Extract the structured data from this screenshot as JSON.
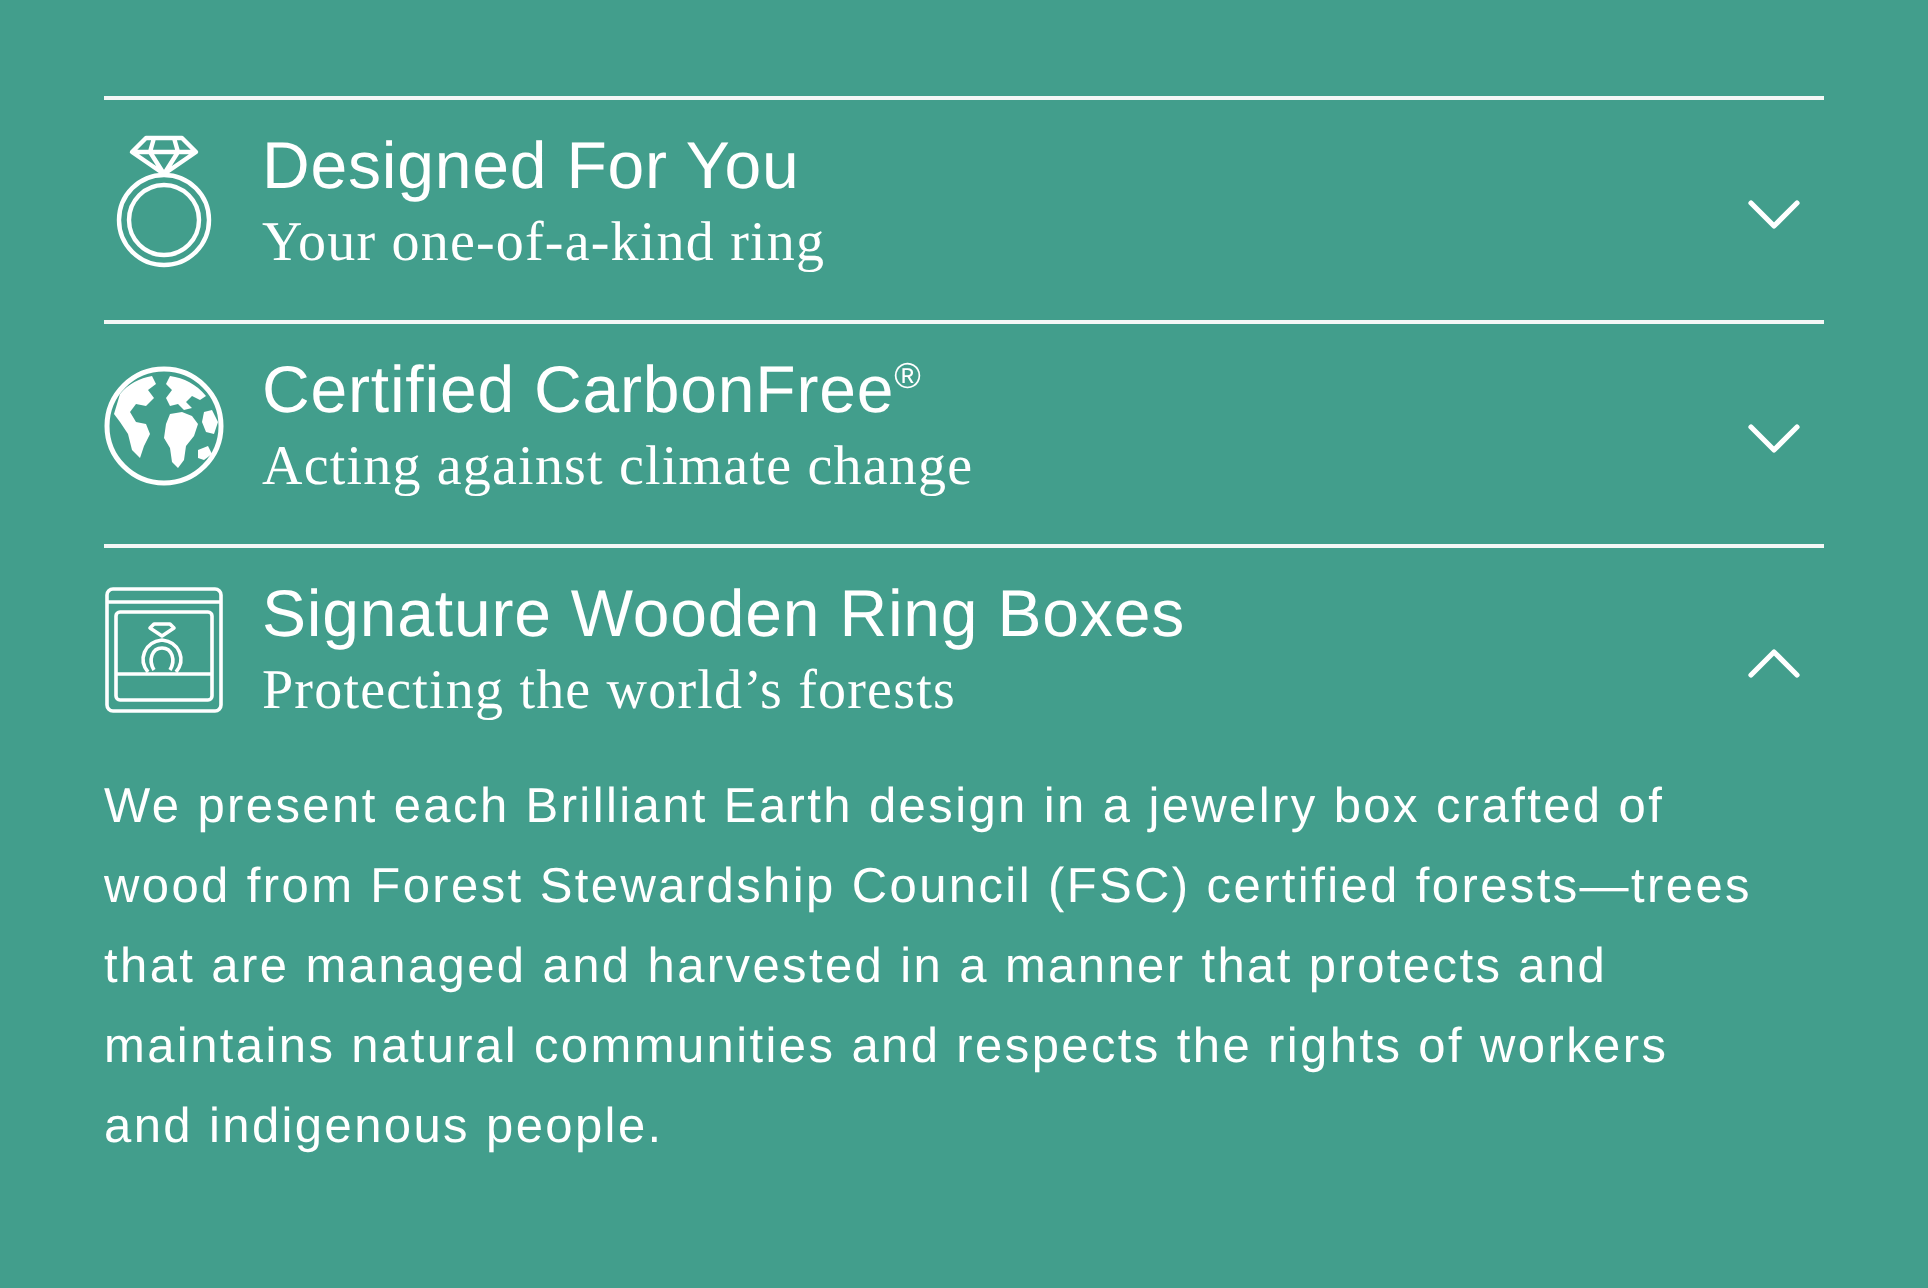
{
  "items": [
    {
      "title": "Designed For You",
      "subtitle": "Your one-of-a-kind ring",
      "expanded": false
    },
    {
      "title": "Certified CarbonFree$^{®}$",
      "subtitle": "Acting against climate change",
      "expanded": false
    },
    {
      "title": "Signature Wooden Ring Boxes",
      "subtitle": "Protecting the world’s forests",
      "expanded": true,
      "body": "We present each Brilliant Earth design in a jewelry box crafted of wood from Forest Stewardship Council (FSC) certified forests—trees that are managed and harvested in a manner that protects and maintains natural communities and respects the rights of workers and indigenous people."
    }
  ]
}
